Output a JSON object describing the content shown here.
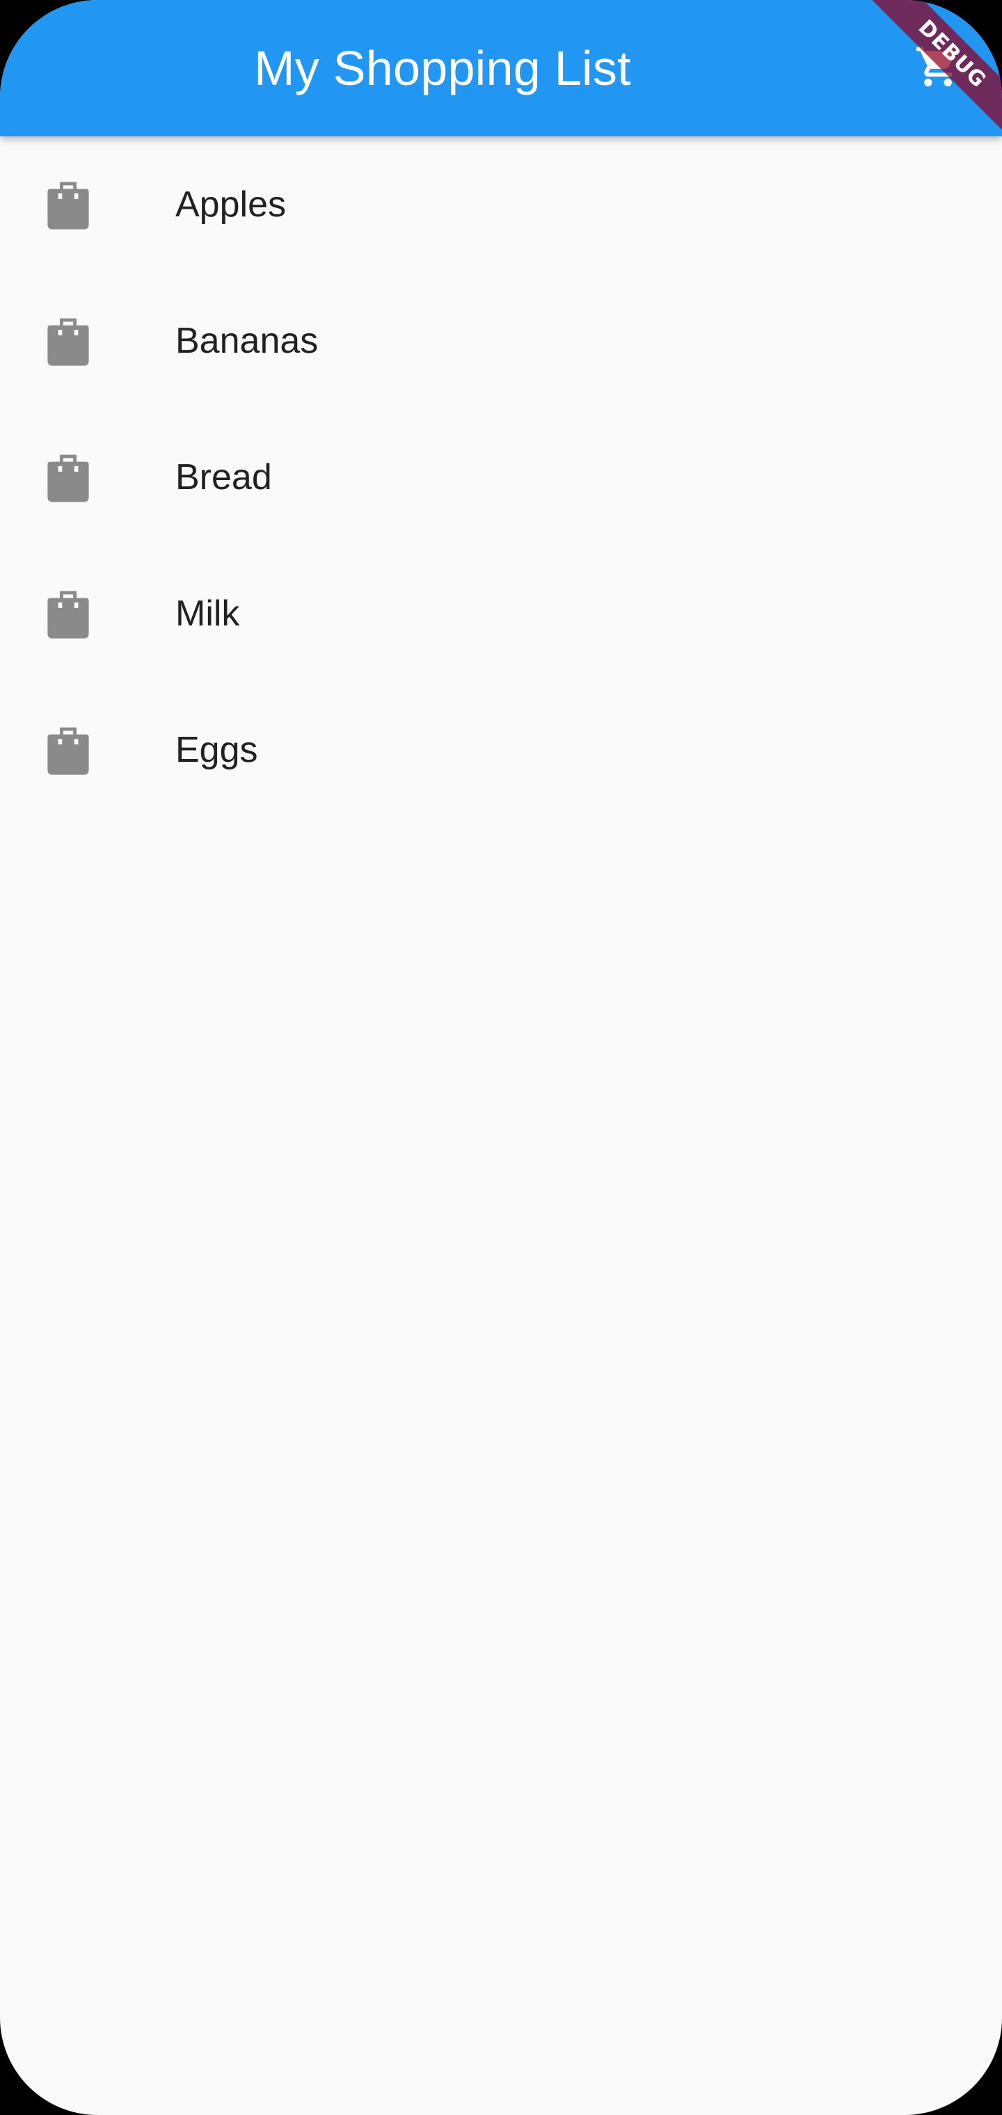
{
  "app_bar": {
    "title": "My Shopping List",
    "background_color": "#2196f3",
    "action_icon": "shopping-cart-icon"
  },
  "debug_banner": {
    "label": "DEBUG"
  },
  "shopping_list": {
    "item_icon": "shopping-bag-icon",
    "icon_color": "#8a8a8a",
    "items": [
      {
        "label": "Apples"
      },
      {
        "label": "Bananas"
      },
      {
        "label": "Bread"
      },
      {
        "label": "Milk"
      },
      {
        "label": "Eggs"
      }
    ]
  }
}
